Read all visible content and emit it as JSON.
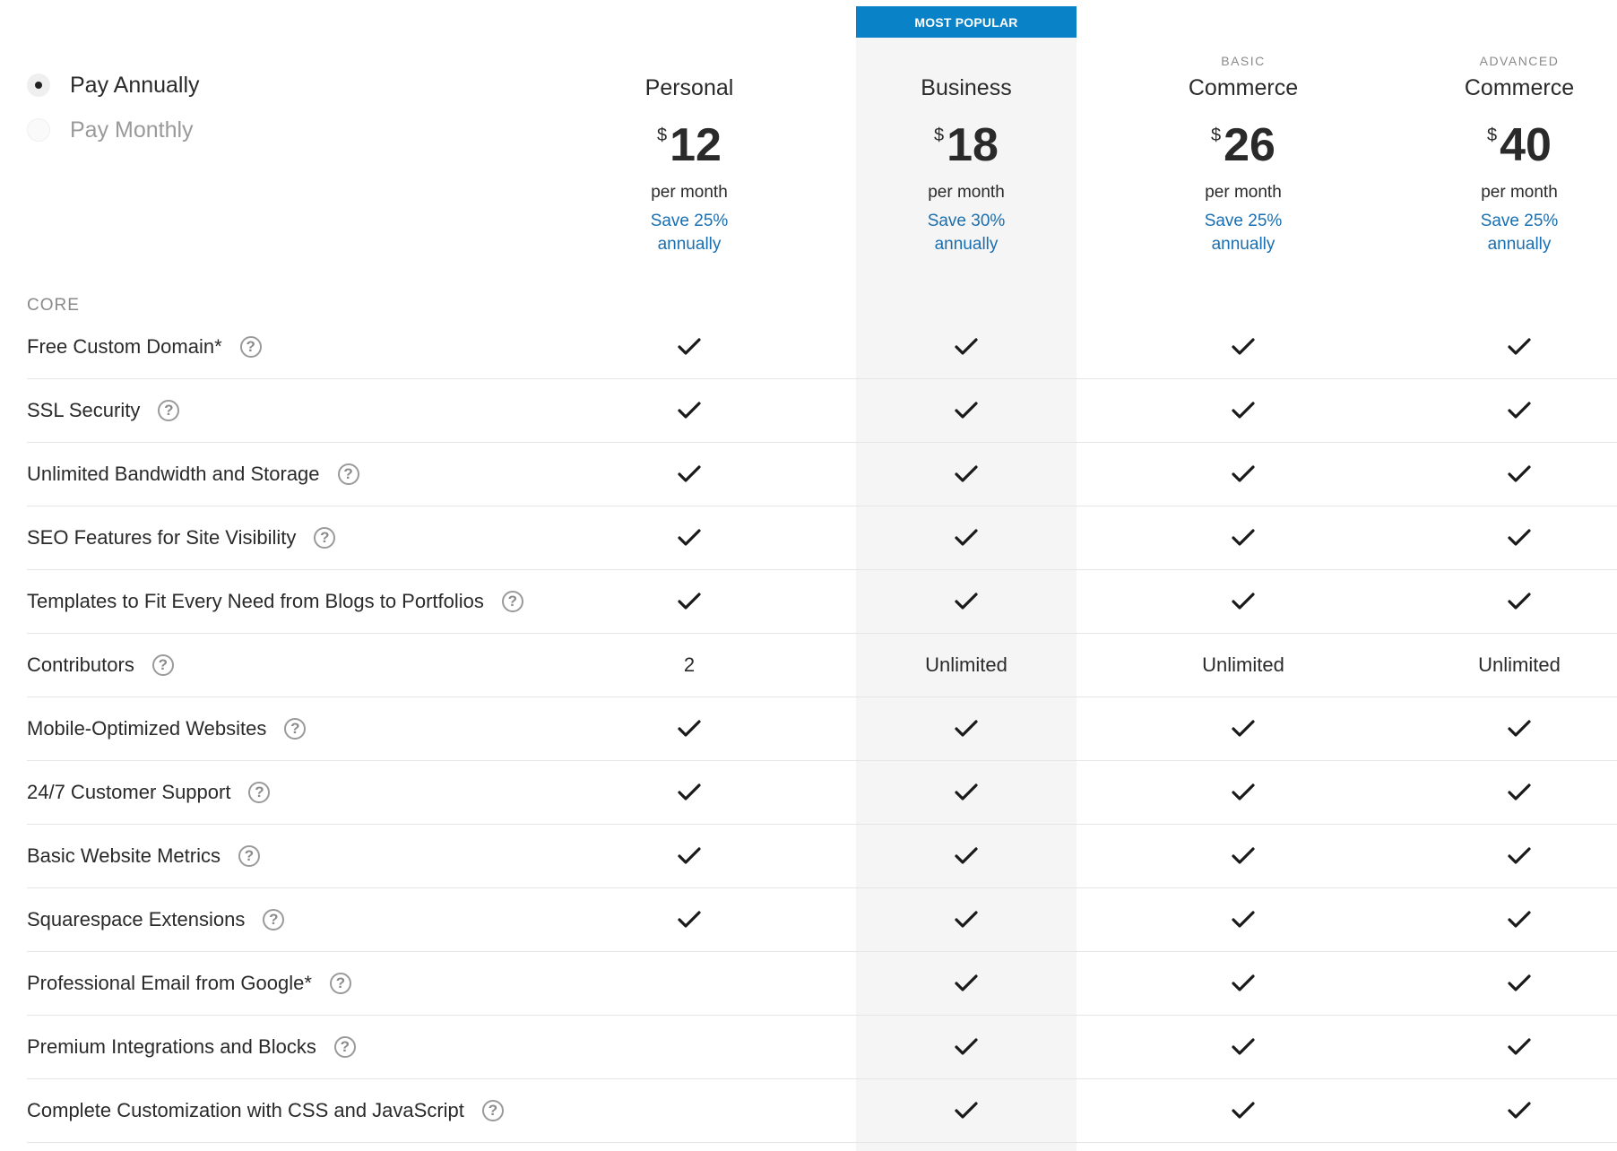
{
  "badge": "MOST POPULAR",
  "billing": {
    "options": [
      {
        "label": "Pay Annually",
        "selected": true
      },
      {
        "label": "Pay Monthly",
        "selected": false
      }
    ]
  },
  "plans": [
    {
      "tier": "",
      "name": "Personal",
      "currency": "$",
      "price": "12",
      "per": "per month",
      "save_line1": "Save 25%",
      "save_line2": "annually"
    },
    {
      "tier": "",
      "name": "Business",
      "currency": "$",
      "price": "18",
      "per": "per month",
      "save_line1": "Save 30%",
      "save_line2": "annually"
    },
    {
      "tier": "BASIC",
      "name": "Commerce",
      "currency": "$",
      "price": "26",
      "per": "per month",
      "save_line1": "Save 25%",
      "save_line2": "annually"
    },
    {
      "tier": "ADVANCED",
      "name": "Commerce",
      "currency": "$",
      "price": "40",
      "per": "per month",
      "save_line1": "Save 25%",
      "save_line2": "annually"
    }
  ],
  "section": "CORE",
  "help_glyph": "?",
  "features": [
    {
      "label": "Free Custom Domain*",
      "values": [
        "check",
        "check",
        "check",
        "check"
      ]
    },
    {
      "label": "SSL Security",
      "values": [
        "check",
        "check",
        "check",
        "check"
      ]
    },
    {
      "label": "Unlimited Bandwidth and Storage",
      "values": [
        "check",
        "check",
        "check",
        "check"
      ]
    },
    {
      "label": "SEO Features for Site Visibility",
      "values": [
        "check",
        "check",
        "check",
        "check"
      ]
    },
    {
      "label": "Templates to Fit Every Need from Blogs to Portfolios",
      "values": [
        "check",
        "check",
        "check",
        "check"
      ]
    },
    {
      "label": "Contributors",
      "values": [
        "2",
        "Unlimited",
        "Unlimited",
        "Unlimited"
      ]
    },
    {
      "label": "Mobile-Optimized Websites",
      "values": [
        "check",
        "check",
        "check",
        "check"
      ]
    },
    {
      "label": "24/7 Customer Support",
      "values": [
        "check",
        "check",
        "check",
        "check"
      ]
    },
    {
      "label": "Basic Website Metrics",
      "values": [
        "check",
        "check",
        "check",
        "check"
      ]
    },
    {
      "label": "Squarespace Extensions",
      "values": [
        "check",
        "check",
        "check",
        "check"
      ]
    },
    {
      "label": "Professional Email from Google*",
      "values": [
        "",
        "check",
        "check",
        "check"
      ]
    },
    {
      "label": "Premium Integrations and Blocks",
      "values": [
        "",
        "check",
        "check",
        "check"
      ]
    },
    {
      "label": "Complete Customization with CSS and JavaScript",
      "values": [
        "",
        "check",
        "check",
        "check"
      ]
    }
  ],
  "colors": {
    "accent": "#0a82c8",
    "save_text": "#1a6fb0",
    "highlight_bg": "#f5f5f5"
  }
}
